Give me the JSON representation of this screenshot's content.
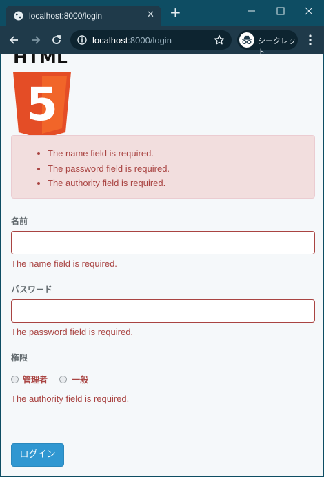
{
  "browser": {
    "tab_title": "localhost:8000/login",
    "url_host": "localhost",
    "url_path": ":8000/login",
    "incognito_label": "シークレット",
    "new_tab_glyph": "+",
    "close_tab_glyph": "✕"
  },
  "logo": {
    "text": "HTML",
    "shield_glyph": "5",
    "colors": {
      "shield": "#e44d26",
      "shield_light": "#f16529",
      "glyph": "#ffffff",
      "text": "#111111"
    }
  },
  "alert": {
    "errors": [
      "The name field is required.",
      "The password field is required.",
      "The authority field is required."
    ]
  },
  "form": {
    "name": {
      "label": "名前",
      "value": "",
      "error": "The name field is required."
    },
    "password": {
      "label": "パスワード",
      "value": "",
      "error": "The password field is required."
    },
    "authority": {
      "label": "権限",
      "options": [
        "管理者",
        "一般"
      ],
      "error": "The authority field is required."
    },
    "submit_label": "ログイン"
  },
  "colors": {
    "chrome_dark": "#0e4d63",
    "error": "#a94442",
    "alert_bg": "#f2dede",
    "primary": "#3097d1",
    "page_bg": "#f5f8fa"
  }
}
